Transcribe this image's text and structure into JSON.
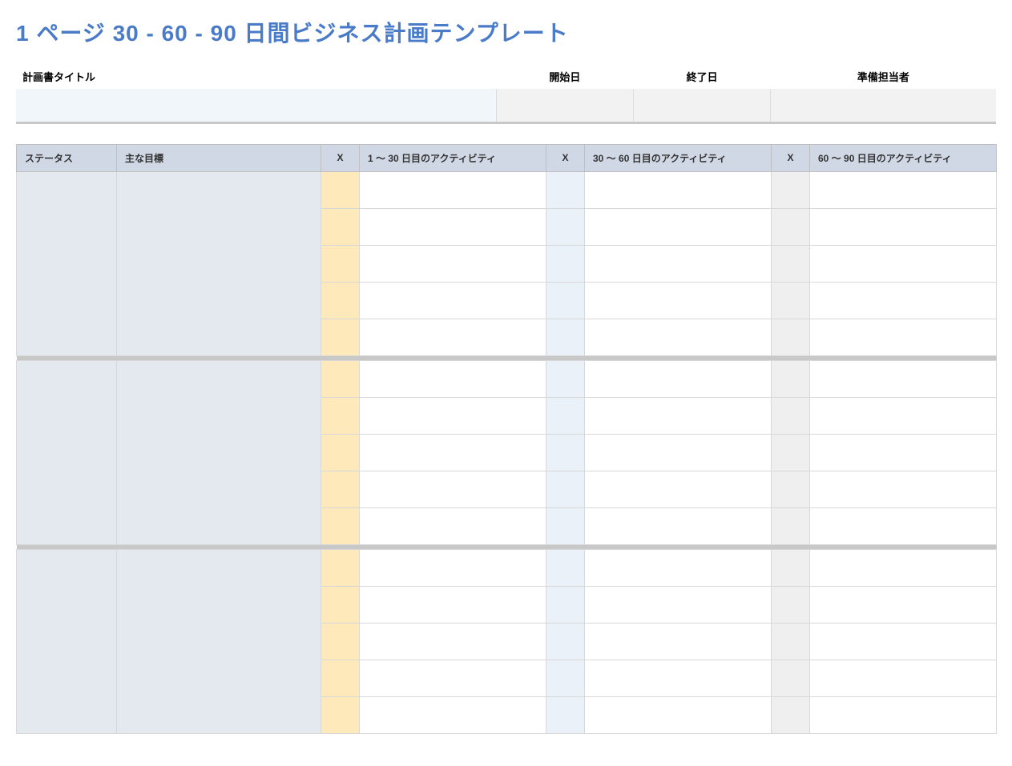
{
  "title": "1 ページ 30 - 60 - 90 日間ビジネス計画テンプレート",
  "header": {
    "labels": {
      "plan_title": "計画書タイトル",
      "start_date": "開始日",
      "end_date": "終了日",
      "prepared_by": "準備担当者"
    },
    "values": {
      "plan_title": "",
      "start_date": "",
      "end_date": "",
      "prepared_by": ""
    }
  },
  "columns": {
    "status": "ステータス",
    "main_goal": "主な目標",
    "x1": "X",
    "act_1_30": "1 ～ 30 日目のアクティビティ",
    "x2": "X",
    "act_30_60": "30 ～ 60 日目のアクティビティ",
    "x3": "X",
    "act_60_90": "60 ～ 90 日目のアクティビティ"
  },
  "groups": [
    {
      "status": "",
      "goal": "",
      "rows": [
        {
          "x1": "",
          "a1": "",
          "x2": "",
          "a2": "",
          "x3": "",
          "a3": ""
        },
        {
          "x1": "",
          "a1": "",
          "x2": "",
          "a2": "",
          "x3": "",
          "a3": ""
        },
        {
          "x1": "",
          "a1": "",
          "x2": "",
          "a2": "",
          "x3": "",
          "a3": ""
        },
        {
          "x1": "",
          "a1": "",
          "x2": "",
          "a2": "",
          "x3": "",
          "a3": ""
        },
        {
          "x1": "",
          "a1": "",
          "x2": "",
          "a2": "",
          "x3": "",
          "a3": ""
        }
      ]
    },
    {
      "status": "",
      "goal": "",
      "rows": [
        {
          "x1": "",
          "a1": "",
          "x2": "",
          "a2": "",
          "x3": "",
          "a3": ""
        },
        {
          "x1": "",
          "a1": "",
          "x2": "",
          "a2": "",
          "x3": "",
          "a3": ""
        },
        {
          "x1": "",
          "a1": "",
          "x2": "",
          "a2": "",
          "x3": "",
          "a3": ""
        },
        {
          "x1": "",
          "a1": "",
          "x2": "",
          "a2": "",
          "x3": "",
          "a3": ""
        },
        {
          "x1": "",
          "a1": "",
          "x2": "",
          "a2": "",
          "x3": "",
          "a3": ""
        }
      ]
    },
    {
      "status": "",
      "goal": "",
      "rows": [
        {
          "x1": "",
          "a1": "",
          "x2": "",
          "a2": "",
          "x3": "",
          "a3": ""
        },
        {
          "x1": "",
          "a1": "",
          "x2": "",
          "a2": "",
          "x3": "",
          "a3": ""
        },
        {
          "x1": "",
          "a1": "",
          "x2": "",
          "a2": "",
          "x3": "",
          "a3": ""
        },
        {
          "x1": "",
          "a1": "",
          "x2": "",
          "a2": "",
          "x3": "",
          "a3": ""
        },
        {
          "x1": "",
          "a1": "",
          "x2": "",
          "a2": "",
          "x3": "",
          "a3": ""
        }
      ]
    }
  ]
}
